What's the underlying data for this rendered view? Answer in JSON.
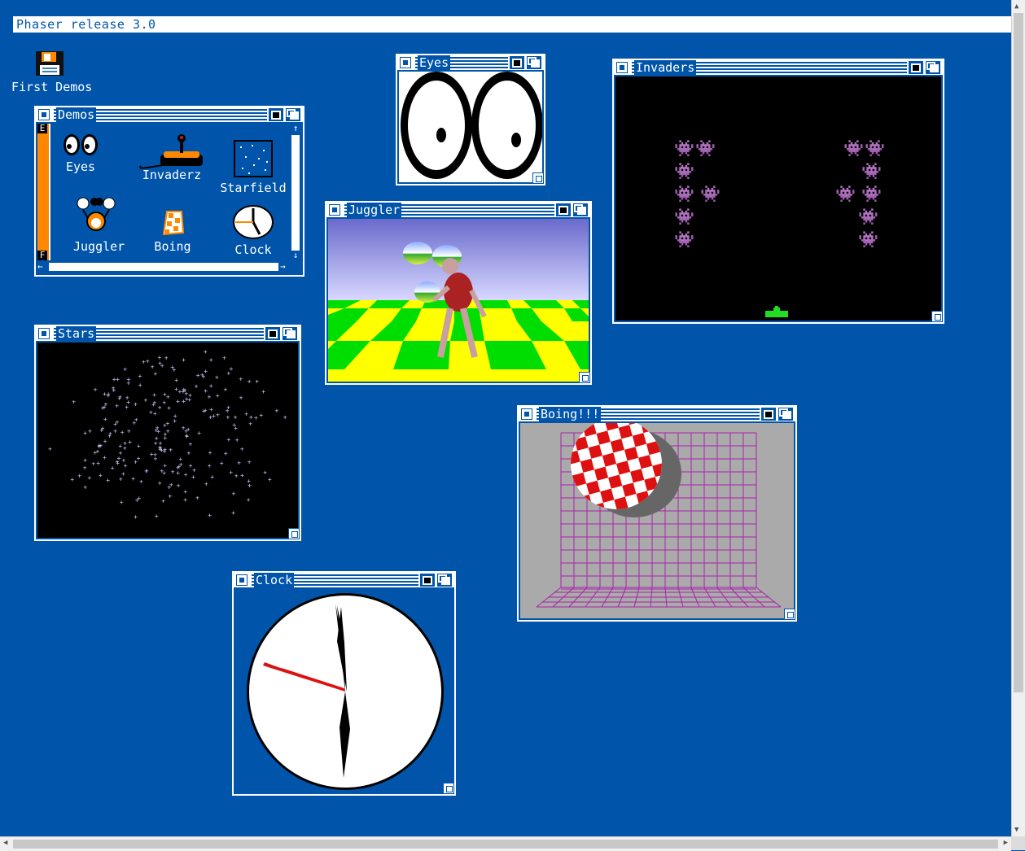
{
  "screen": {
    "title": "Phaser release 3.0"
  },
  "desktop": {
    "disk_label": "First Demos"
  },
  "windows": {
    "demos": {
      "title": "Demos",
      "gauge_top": "E",
      "gauge_bottom": "F",
      "items": [
        {
          "label": "Eyes"
        },
        {
          "label": "Invaderz"
        },
        {
          "label": "Starfield"
        },
        {
          "label": "Juggler"
        },
        {
          "label": "Boing"
        },
        {
          "label": "Clock"
        }
      ]
    },
    "eyes": {
      "title": "Eyes"
    },
    "invaders": {
      "title": "Invaders"
    },
    "juggler": {
      "title": "Juggler"
    },
    "stars": {
      "title": "Stars"
    },
    "boing": {
      "title": "Boing!!!"
    },
    "clock": {
      "title": "Clock"
    }
  },
  "colors": {
    "workbench_blue": "#0055aa",
    "white": "#ffffff",
    "gauge_orange": "#ff8800",
    "invader_red": "#dd1111",
    "invader_green": "#22dd22",
    "invader_cyan": "#22dddd",
    "boing_red": "#dd1111",
    "grid_magenta": "#aa22aa"
  }
}
